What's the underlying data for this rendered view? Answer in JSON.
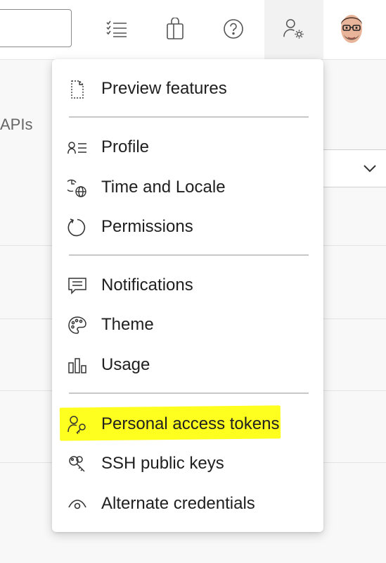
{
  "header": {
    "search": {
      "value": ""
    },
    "icons": [
      "task-list-icon",
      "marketplace-bag-icon",
      "help-icon",
      "user-settings-icon"
    ]
  },
  "background": {
    "apis_label": "APIs"
  },
  "menu": {
    "items": [
      {
        "label": "Preview features",
        "icon": "preview-features-icon"
      },
      {
        "label": "Profile",
        "icon": "profile-icon"
      },
      {
        "label": "Time and Locale",
        "icon": "time-locale-icon"
      },
      {
        "label": "Permissions",
        "icon": "permissions-icon"
      },
      {
        "label": "Notifications",
        "icon": "notifications-icon"
      },
      {
        "label": "Theme",
        "icon": "theme-palette-icon"
      },
      {
        "label": "Usage",
        "icon": "usage-chart-icon"
      },
      {
        "label": "Personal access tokens",
        "icon": "personal-access-tokens-icon",
        "highlighted": true
      },
      {
        "label": "SSH public keys",
        "icon": "ssh-keys-icon"
      },
      {
        "label": "Alternate credentials",
        "icon": "alternate-credentials-icon"
      }
    ]
  },
  "colors": {
    "highlight": "#ffff1f",
    "menu_bg": "#ffffff",
    "separator": "#c8c8c8"
  }
}
